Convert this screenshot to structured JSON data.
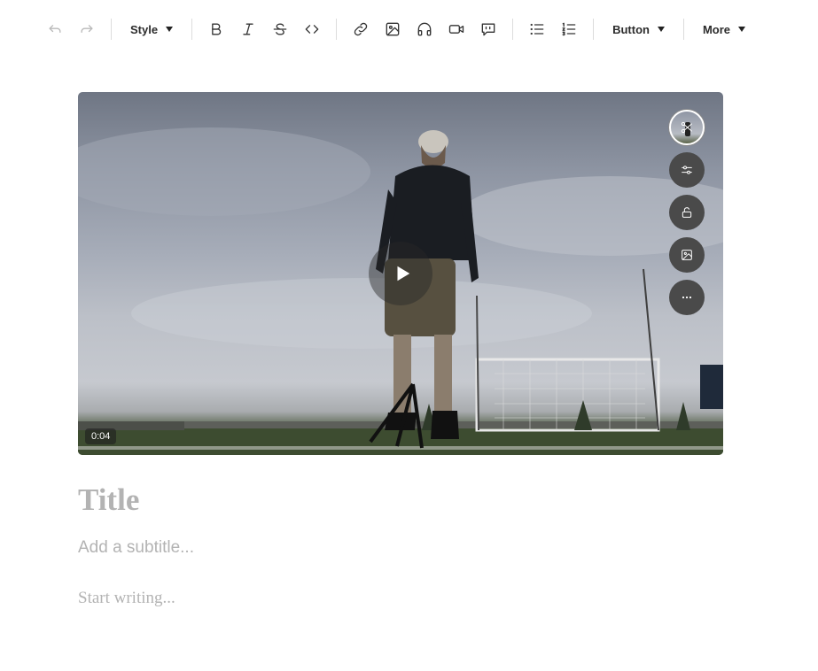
{
  "toolbar": {
    "style_label": "Style",
    "button_label": "Button",
    "more_label": "More",
    "icons": [
      "undo-icon",
      "redo-icon",
      "bold-icon",
      "italic-icon",
      "strikethrough-icon",
      "code-icon",
      "link-icon",
      "image-icon",
      "audio-icon",
      "video-icon",
      "quote-icon",
      "bullet-list-icon",
      "numbered-list-icon"
    ]
  },
  "video": {
    "duration": "0:04",
    "side_actions": [
      "thumbnail-icon",
      "settings-sliders-icon",
      "unlock-icon",
      "image-icon",
      "more-icon"
    ]
  },
  "editor": {
    "title_placeholder": "Title",
    "subtitle_placeholder": "Add a subtitle...",
    "body_placeholder": "Start writing..."
  },
  "colors": {
    "placeholder": "#b3b3b3",
    "side_button": "#4a4a4a"
  }
}
